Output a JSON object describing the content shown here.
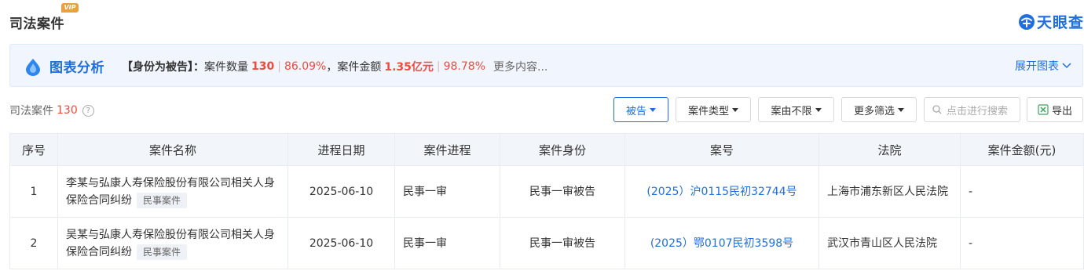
{
  "header": {
    "title": "司法案件",
    "vip_badge": "VIP",
    "brand": "天眼查",
    "brand_color": "#1f6fe0"
  },
  "banner": {
    "title": "图表分析",
    "role_label": "【身份为被告】：",
    "count_label": "案件数量",
    "count_value": "130",
    "count_pct": "86.09%",
    "amount_label": "，案件金额",
    "amount_value": "1.35亿元",
    "amount_pct": "98.78%",
    "more": "更多内容...",
    "expand": "展开图表"
  },
  "toolbar": {
    "label": "司法案件",
    "count": "130",
    "help_icon": "?",
    "filter_defendant": "被告",
    "filter_case_type": "案件类型",
    "filter_cause": "案由不限",
    "filter_more": "更多筛选",
    "search_placeholder": "点击进行搜索",
    "export": "导出"
  },
  "table": {
    "headers": [
      "序号",
      "案件名称",
      "进程日期",
      "案件进程",
      "案件身份",
      "案号",
      "法院",
      "案件金额(元)"
    ],
    "rows": [
      {
        "index": "1",
        "name": "李某与弘康人寿保险股份有限公司相关人身保险合同纠纷",
        "tag": "民事案件",
        "date": "2025-06-10",
        "stage": "民事一审",
        "role": "民事一审被告",
        "case_no": "(2025）沪0115民初32744号",
        "court": "上海市浦东新区人民法院",
        "amount": "-"
      },
      {
        "index": "2",
        "name": "吴某与弘康人寿保险股份有限公司相关人身保险合同纠纷",
        "tag": "民事案件",
        "date": "2025-06-10",
        "stage": "民事一审",
        "role": "民事一审被告",
        "case_no": "(2025）鄂0107民初3598号",
        "court": "武汉市青山区人民法院",
        "amount": "-"
      }
    ]
  }
}
